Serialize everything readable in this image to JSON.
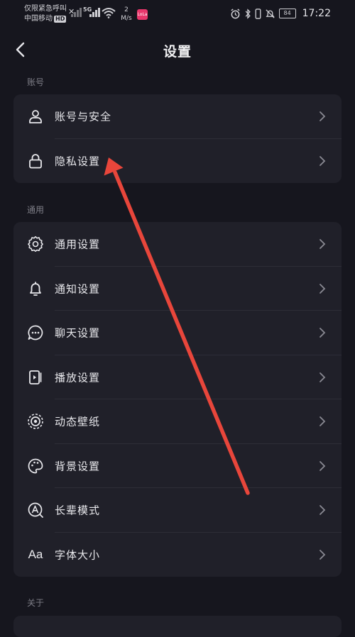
{
  "status_bar": {
    "carrier_line1": "仅限紧急呼叫",
    "carrier_line2": "中国移动",
    "hd_label": "HD",
    "signal_label": "5G",
    "speed_value": "2",
    "speed_unit": "M/s",
    "app_badge": "LoLa",
    "battery_level": "84",
    "time": "17:22"
  },
  "header": {
    "title": "设置"
  },
  "sections": {
    "account": {
      "label": "账号",
      "items": [
        {
          "label": "账号与安全",
          "icon": "user-icon"
        },
        {
          "label": "隐私设置",
          "icon": "lock-icon"
        }
      ]
    },
    "general": {
      "label": "通用",
      "items": [
        {
          "label": "通用设置",
          "icon": "gear-icon"
        },
        {
          "label": "通知设置",
          "icon": "bell-icon"
        },
        {
          "label": "聊天设置",
          "icon": "chat-icon"
        },
        {
          "label": "播放设置",
          "icon": "play-icon"
        },
        {
          "label": "动态壁纸",
          "icon": "wallpaper-icon"
        },
        {
          "label": "背景设置",
          "icon": "palette-icon"
        },
        {
          "label": "长辈模式",
          "icon": "elder-mode-icon"
        },
        {
          "label": "字体大小",
          "icon": "font-size-icon",
          "glyph": "Aa"
        }
      ]
    },
    "about": {
      "label": "关于"
    }
  },
  "annotation": {
    "arrow_color": "#e8463b"
  },
  "colors": {
    "background": "#16161e",
    "card": "#202029",
    "text": "#e8e8ec",
    "muted": "#7d7d86"
  }
}
